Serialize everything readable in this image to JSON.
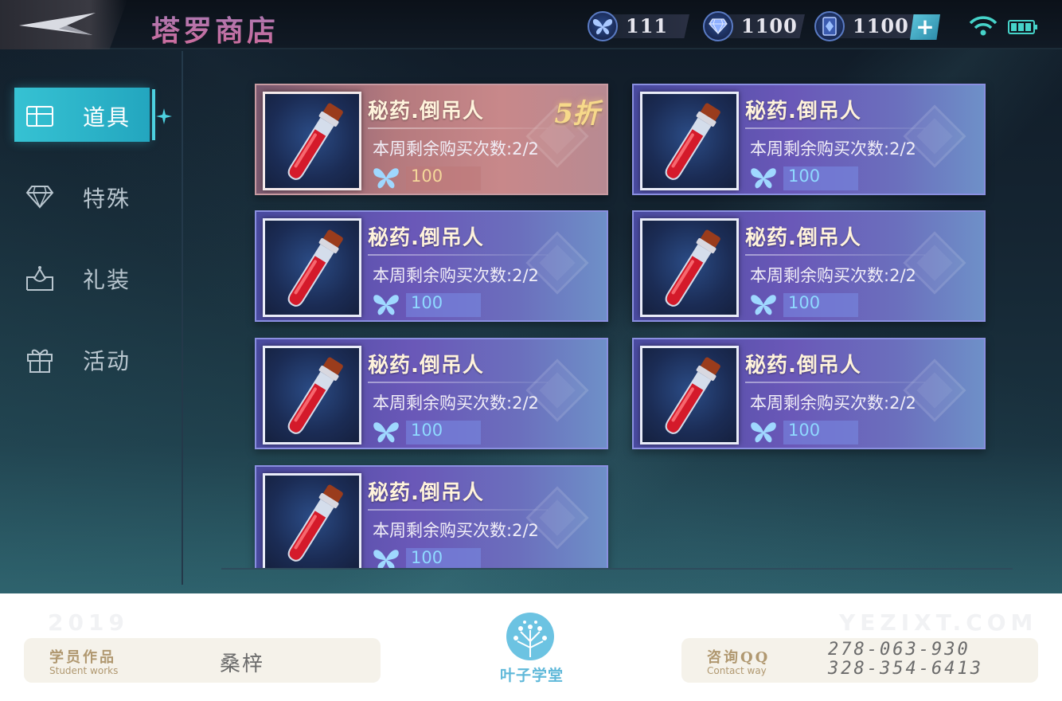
{
  "app": {
    "title": "塔罗商店"
  },
  "currencies": [
    {
      "icon": "butterfly-icon",
      "value": "111"
    },
    {
      "icon": "diamond-icon",
      "value": "1100"
    },
    {
      "icon": "crystal-card-icon",
      "value": "1100"
    }
  ],
  "topbar": {
    "add_label": "+",
    "status_icons": [
      "wifi-icon",
      "battery-icon"
    ]
  },
  "sidebar": {
    "items": [
      {
        "label": "道具",
        "icon": "chest-icon",
        "active": true
      },
      {
        "label": "特殊",
        "icon": "diamond-outline-icon",
        "active": false
      },
      {
        "label": "礼装",
        "icon": "costume-icon",
        "active": false
      },
      {
        "label": "活动",
        "icon": "gift-icon",
        "active": false
      }
    ]
  },
  "items": [
    {
      "name": "秘药.倒吊人",
      "limit_label": "本周剩余购买次数:",
      "limit_value": "2/2",
      "price": "100",
      "badge": "5折",
      "icon": "potion-icon"
    },
    {
      "name": "秘药.倒吊人",
      "limit_label": "本周剩余购买次数:",
      "limit_value": "2/2",
      "price": "100",
      "badge": "",
      "icon": "potion-icon"
    },
    {
      "name": "秘药.倒吊人",
      "limit_label": "本周剩余购买次数:",
      "limit_value": "2/2",
      "price": "100",
      "badge": "",
      "icon": "potion-icon"
    },
    {
      "name": "秘药.倒吊人",
      "limit_label": "本周剩余购买次数:",
      "limit_value": "2/2",
      "price": "100",
      "badge": "",
      "icon": "potion-icon"
    },
    {
      "name": "秘药.倒吊人",
      "limit_label": "本周剩余购买次数:",
      "limit_value": "2/2",
      "price": "100",
      "badge": "",
      "icon": "potion-icon"
    },
    {
      "name": "秘药.倒吊人",
      "limit_label": "本周剩余购买次数:",
      "limit_value": "2/2",
      "price": "100",
      "badge": "",
      "icon": "potion-icon"
    },
    {
      "name": "秘药.倒吊人",
      "limit_label": "本周剩余购买次数:",
      "limit_value": "2/2",
      "price": "100",
      "badge": "",
      "icon": "potion-icon"
    }
  ],
  "footer": {
    "watermark_year": "2019",
    "watermark_site": "YEZIXT.COM",
    "student_title": "学员作品",
    "student_subtitle": "Student works",
    "student_name": "桑梓",
    "logo_text": "叶子学堂",
    "contact_title": "咨询QQ",
    "contact_subtitle": "Contact way",
    "contact_qq_1": "278-063-930",
    "contact_qq_2": "328-354-6413"
  },
  "colors": {
    "accent": "#36c2d3",
    "card": "#6a58b8",
    "card_discount": "#b57a7e",
    "price_text": "#8fd9ff",
    "badge": "#f7d98a"
  }
}
